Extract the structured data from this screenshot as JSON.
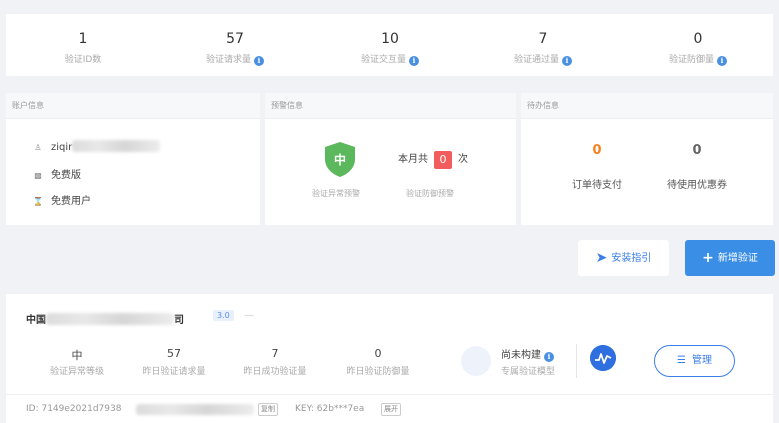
{
  "stats": [
    {
      "value": "1",
      "label": "验证ID数",
      "info": false
    },
    {
      "value": "57",
      "label": "验证请求量",
      "info": true
    },
    {
      "value": "10",
      "label": "验证交互量",
      "info": true
    },
    {
      "value": "7",
      "label": "验证通过量",
      "info": true
    },
    {
      "value": "0",
      "label": "验证防御量",
      "info": true
    }
  ],
  "account": {
    "header": "账户信息",
    "username": "ziqir",
    "plan": "免费版",
    "user_type": "免费用户"
  },
  "warning": {
    "header": "预警信息",
    "level": "中",
    "level_label": "验证异常预警",
    "month_prefix": "本月共",
    "month_count": "0",
    "month_suffix": "次",
    "defense_label": "验证防御预警"
  },
  "todo": {
    "header": "待办信息",
    "pending_orders": "0",
    "pending_orders_label": "订单待支付",
    "coupons": "0",
    "coupons_label": "待使用优惠券"
  },
  "buttons": {
    "guide": "安装指引",
    "add": "新增验证"
  },
  "app": {
    "name_prefix": "中国",
    "name_suffix": "司",
    "version": "3.0",
    "dash": "—",
    "metrics": [
      {
        "value": "中",
        "label": "验证异常等级"
      },
      {
        "value": "57",
        "label": "昨日验证请求量"
      },
      {
        "value": "7",
        "label": "昨日成功验证量"
      },
      {
        "value": "0",
        "label": "昨日验证防御量"
      }
    ],
    "model_title": "尚未构建",
    "model_sub": "专属验证模型",
    "manage": "管理",
    "id_label": "ID: 7149e2021d7938",
    "copy": "复制",
    "key_label": "KEY: 62b***7ea",
    "expand": "展开"
  },
  "colors": {
    "accent": "#3a8ee6",
    "orange": "#f5821f",
    "danger": "#f25c5c",
    "shield": "#5cb85c"
  }
}
